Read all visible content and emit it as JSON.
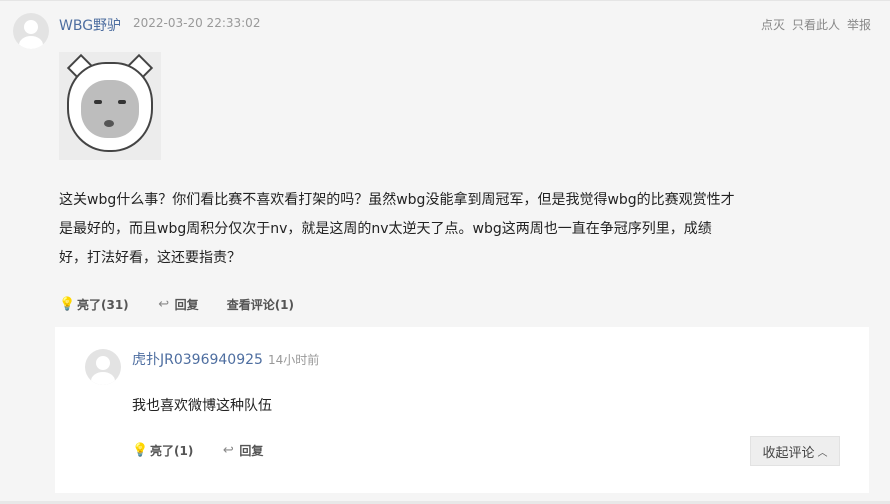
{
  "post": {
    "username": "WBG野驴",
    "time": "2022-03-20 22:33:02",
    "ops": {
      "dim": "点灭",
      "only_this": "只看此人",
      "report": "举报"
    },
    "sticker_icon": "cat-face-meme-sticker",
    "content_lines": [
      "这关wbg什么事？你们看比赛不喜欢看打架的吗？虽然wbg没能拿到周冠军，但是我觉得wbg的比赛观赏性才",
      "是最好的，而且wbg周积分仅次于nv，就是这周的nv太逆天了点。wbg这两周也一直在争冠序列里，成绩",
      "好，打法好看，这还要指责？"
    ],
    "actions": {
      "like_label": "亮了(31)",
      "reply_label": "回复",
      "view_comments_label": "查看评论(1)"
    }
  },
  "reply": {
    "username": "虎扑JR0396940925",
    "time": "14小时前",
    "text": "我也喜欢微博这种队伍",
    "like_label": "亮了(1)",
    "reply_label": "回复",
    "collapse_label": "收起评论"
  },
  "colors": {
    "link_blue": "#4e6ea0",
    "background": "#f5f5f5"
  }
}
